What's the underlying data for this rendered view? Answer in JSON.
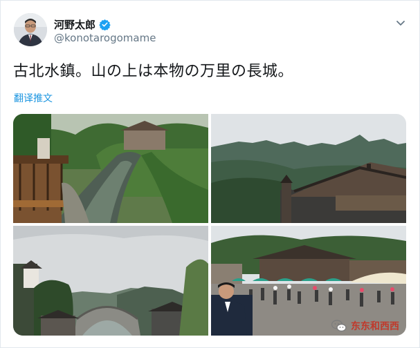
{
  "author": {
    "display_name": "河野太郎",
    "handle": "@konotarogomame",
    "verified": true,
    "verified_icon": "verified-badge-icon",
    "accent_color": "#1da1f2"
  },
  "tweet": {
    "text": "古北水鎮。山の上は本物の万里の長城。",
    "translate_label": "翻译推文",
    "translate_color": "#1b95e0"
  },
  "media": {
    "photo_count": 4,
    "photos": [
      {
        "label": "canal-village-photo"
      },
      {
        "label": "great-wall-mountain-photo"
      },
      {
        "label": "arched-bridge-photo"
      },
      {
        "label": "town-square-crowd-photo"
      }
    ]
  },
  "watermark": {
    "text": "东东和西西",
    "icon": "wechat-logo-icon",
    "color": "#c0392b"
  },
  "menu": {
    "icon": "chevron-down-icon"
  }
}
